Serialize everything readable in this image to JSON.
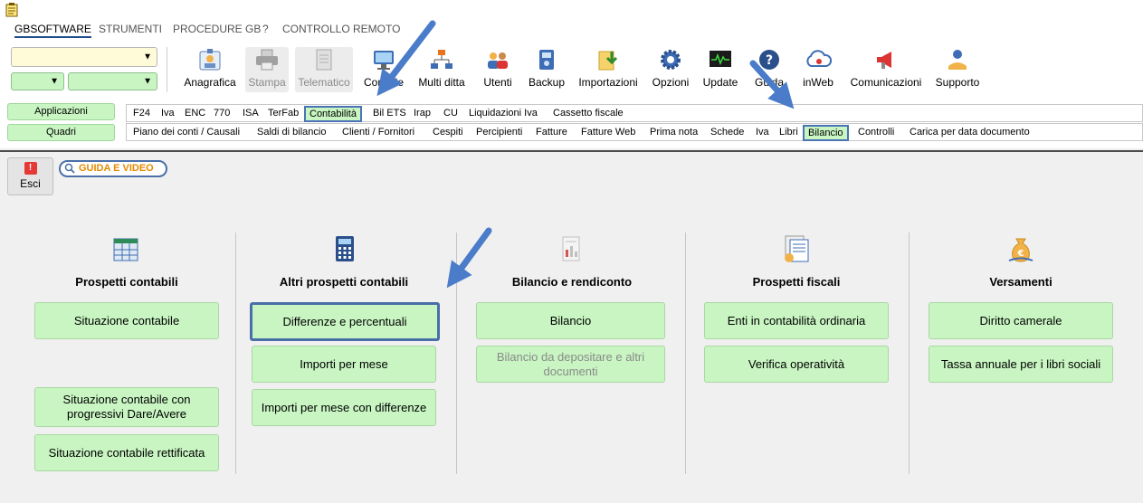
{
  "menu": [
    "GBSOFTWARE",
    "STRUMENTI",
    "PROCEDURE GB",
    "?",
    "CONTROLLO REMOTO"
  ],
  "toolbar": {
    "anagrafica": "Anagrafica",
    "stampa": "Stampa",
    "telematico": "Telematico",
    "console": "Console",
    "multiditta": "Multi ditta",
    "utenti": "Utenti",
    "backup": "Backup",
    "importazioni": "Importazioni",
    "opzioni": "Opzioni",
    "update": "Update",
    "guida": "Guida",
    "inweb": "inWeb",
    "comunicazioni": "Comunicazioni",
    "supporto": "Supporto"
  },
  "side": {
    "applicazioni": "Applicazioni",
    "quadri": "Quadri"
  },
  "tabs_top": [
    "F24",
    "Iva",
    "ENC",
    "770",
    "ISA",
    "TerFab",
    "Contabilità",
    "Bil ETS",
    "Irap",
    "CU",
    "Liquidazioni Iva",
    "Cassetto fiscale"
  ],
  "tabs_bottom": [
    "Piano dei conti / Causali",
    "Saldi di bilancio",
    "Clienti / Fornitori",
    "Cespiti",
    "Percipienti",
    "Fatture",
    "Fatture Web",
    "Prima nota",
    "Schede",
    "Iva",
    "Libri",
    "Bilancio",
    "Controlli",
    "Carica per data documento"
  ],
  "esci": "Esci",
  "guida_video": "GUIDA E VIDEO",
  "columns": {
    "c1": {
      "title": "Prospetti contabili",
      "b1": "Situazione contabile",
      "b2": "Situazione contabile con progressivi Dare/Avere",
      "b3": "Situazione contabile rettificata"
    },
    "c2": {
      "title": "Altri prospetti contabili",
      "b1": "Differenze e percentuali",
      "b2": "Importi per mese",
      "b3": "Importi per mese con differenze"
    },
    "c3": {
      "title": "Bilancio e rendiconto",
      "b1": "Bilancio",
      "b2": "Bilancio da depositare e altri documenti"
    },
    "c4": {
      "title": "Prospetti fiscali",
      "b1": "Enti in contabilità ordinaria",
      "b2": "Verifica operatività"
    },
    "c5": {
      "title": "Versamenti",
      "b1": "Diritto camerale",
      "b2": "Tassa annuale per i libri sociali"
    }
  },
  "colors": {
    "green": "#c8f5c2",
    "highlight": "#4a6fa8",
    "arrow": "#4a7cc9"
  }
}
